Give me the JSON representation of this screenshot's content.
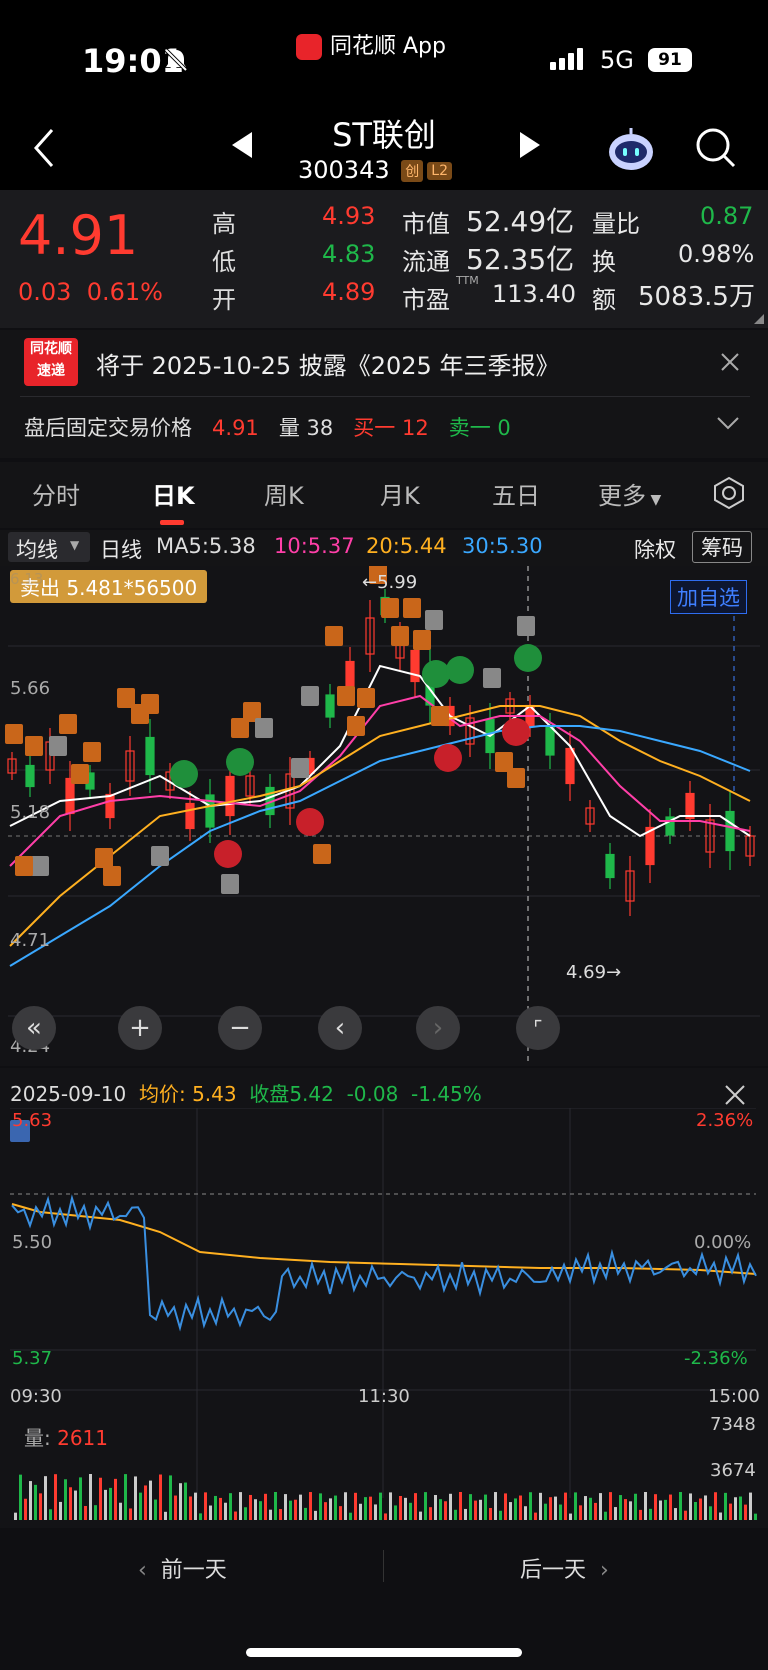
{
  "status_bar": {
    "time": "19:01",
    "app_name": "同花顺 App",
    "network": "5G",
    "battery": "91"
  },
  "header": {
    "stock_name": "ST联创",
    "stock_code": "300343",
    "tag1": "创",
    "tag2": "L2"
  },
  "quote": {
    "price": "4.91",
    "change": "0.03",
    "change_pct": "0.61%",
    "high_label": "高",
    "high": "4.93",
    "low_label": "低",
    "low": "4.83",
    "open_label": "开",
    "open": "4.89",
    "mkt_cap_label": "市值",
    "mkt_cap": "52.49亿",
    "float_label": "流通",
    "float_cap": "52.35亿",
    "pe_label": "市盈",
    "pe_sup": "TTM",
    "pe": "113.40",
    "vol_ratio_label": "量比",
    "vol_ratio": "0.87",
    "turnover_label": "换",
    "turnover": "0.98%",
    "amount_label": "额",
    "amount": "5083.5万"
  },
  "notice": {
    "logo_line1": "同花顺",
    "logo_line2": "速递",
    "text": "将于 2025-10-25 披露《2025 年三季报》",
    "after_label": "盘后固定交易价格",
    "after_price": "4.91",
    "vol_label": "量",
    "vol": "38",
    "buy1": "买一 12",
    "sell1": "卖一 0"
  },
  "tabs": [
    "分时",
    "日K",
    "周K",
    "月K",
    "五日",
    "更多"
  ],
  "ma_row": {
    "selector": "均线",
    "type": "日线",
    "ma5": "MA5:5.38",
    "ma10": "10:5.37",
    "ma20": "20:5.44",
    "ma30": "30:5.30",
    "exrights": "除权",
    "chips": "筹码"
  },
  "kchart": {
    "sell_badge": "卖出 5.481*56500",
    "add_watch": "加自选",
    "y_top": "5.66",
    "y_mid": "5.18",
    "y_low": "4.71",
    "y_bottom": "4.24",
    "y_top_hidden": "6.13",
    "high_mark": "5.99",
    "low_mark": "4.69"
  },
  "chart_data": [
    {
      "type": "line",
      "title": "",
      "series": [
        {
          "name": "MA5",
          "color": "#ffffff"
        },
        {
          "name": "10",
          "color": "#ff3fa8"
        },
        {
          "name": "20",
          "color": "#ffb020"
        },
        {
          "name": "30",
          "color": "#3aa8ff"
        }
      ],
      "ylim": [
        4.24,
        6.13
      ]
    },
    {
      "type": "line",
      "title": "",
      "x": [
        "09:30",
        "11:30",
        "15:00"
      ],
      "ylim": [
        5.37,
        5.63
      ],
      "pct_range": [
        "2.36%",
        "0.00%",
        "-2.36%"
      ]
    }
  ],
  "intraday": {
    "date": "2025-09-10",
    "avg_label": "均价:",
    "avg": "5.43",
    "close_label": "收盘",
    "close": "5.42",
    "chg": "-0.08",
    "chg_pct": "-1.45%",
    "y_high": "5.63",
    "y_mid": "5.50",
    "y_low": "5.37",
    "pct_high": "2.36%",
    "pct_mid": "0.00%",
    "pct_low": "-2.36%",
    "t_start": "09:30",
    "t_mid": "11:30",
    "t_end": "15:00",
    "vol_label": "量:",
    "vol_value": "2611",
    "vol_top": "7348",
    "vol_mid": "3674"
  },
  "bottom_nav": {
    "prev": "前一天",
    "next": "后一天"
  }
}
